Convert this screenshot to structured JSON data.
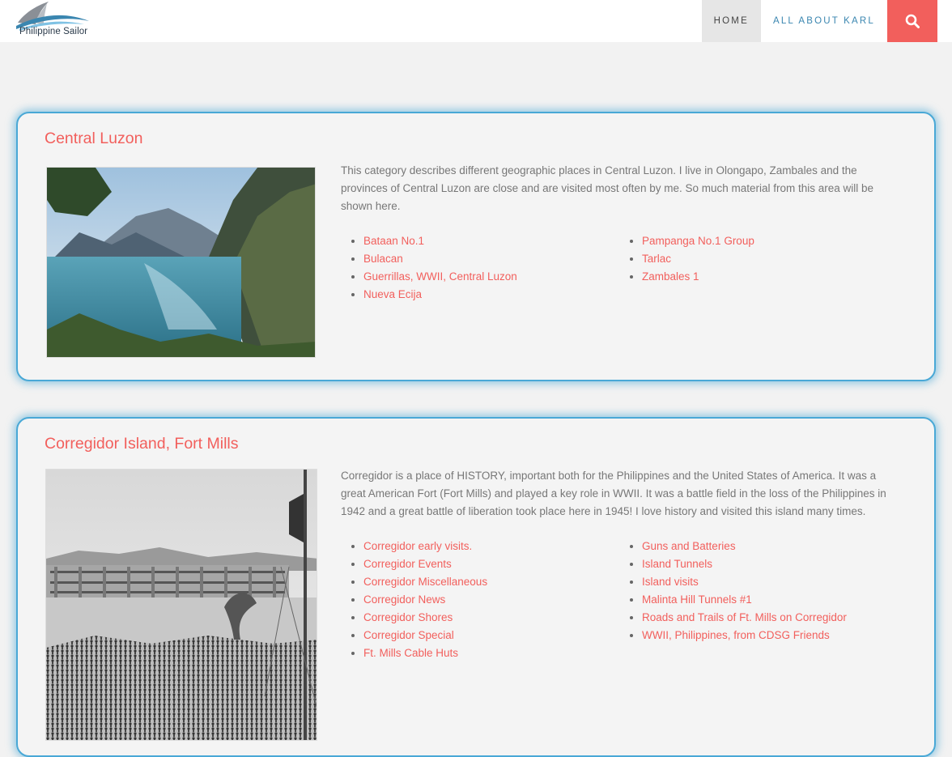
{
  "header": {
    "logo_text": "Philippine Sailor",
    "nav": {
      "home": "HOME",
      "about": "ALL ABOUT KARL"
    },
    "search_icon": "search-icon",
    "accent_color": "#f25f5c",
    "nav_link_color": "#3a86b0"
  },
  "categories": [
    {
      "title": "Central Luzon",
      "image": "lake-landscape-photo",
      "description": "This category describes different geographic places in Central Luzon. I live in Olongapo, Zambales and the provinces of Central Luzon are close and are visited most often by me. So much material from this area will be shown here.",
      "links_left": [
        "Bataan No.1",
        "Bulacan",
        "Guerrillas, WWII, Central Luzon",
        "Nueva Ecija"
      ],
      "links_right": [
        "Pampanga No.1 Group",
        "Tarlac",
        "Zambales 1"
      ]
    },
    {
      "title": "Corregidor Island, Fort Mills",
      "image": "corregidor-parade-photo",
      "description": "Corregidor is a place of HISTORY, important both for the Philippines and the United States of America. It was a great American Fort (Fort Mills) and played a key role in WWII. It was a battle field in the loss of the Philippines in 1942 and a great battle of liberation took place here in 1945! I love history and visited this island many times.",
      "links_left": [
        "Corregidor early visits.",
        "Corregidor Events",
        "Corregidor Miscellaneous",
        "Corregidor News",
        "Corregidor Shores",
        "Corregidor Special",
        "Ft. Mills Cable Huts"
      ],
      "links_right": [
        "Guns and Batteries",
        "Island Tunnels",
        "Island visits",
        "Malinta Hill Tunnels #1",
        "Roads and Trails of Ft. Mills on Corregidor",
        "WWII, Philippines, from CDSG Friends"
      ]
    }
  ]
}
